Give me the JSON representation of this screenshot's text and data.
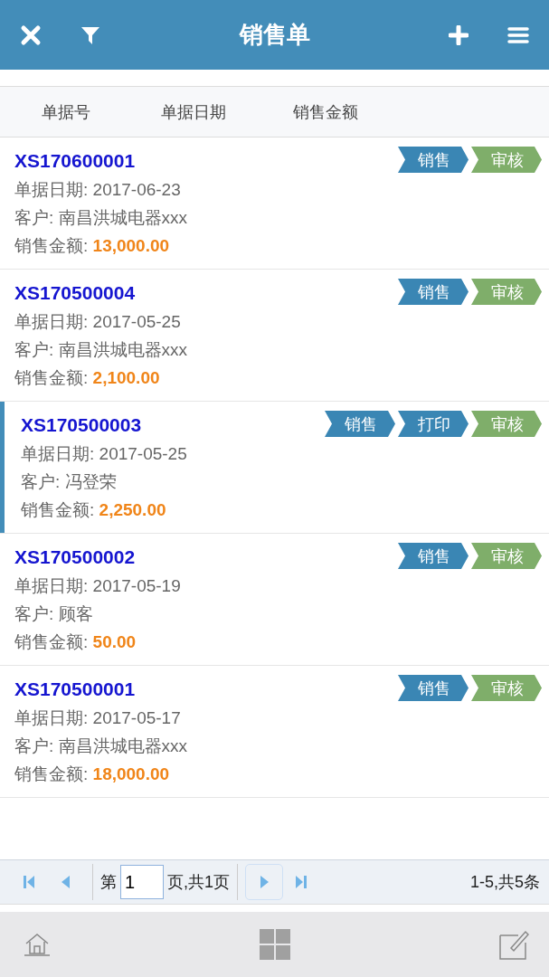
{
  "header": {
    "title": "销售单"
  },
  "columns": [
    "单据号",
    "单据日期",
    "销售金额"
  ],
  "orders": [
    {
      "number": "XS170600001",
      "selected": false,
      "tags": [
        {
          "label": "销售",
          "color": "#3a86b4"
        },
        {
          "label": "审核",
          "color": "#7fae6a"
        }
      ],
      "lines": [
        {
          "label": "单据日期:",
          "value": "2017-06-23",
          "kind": "plain"
        },
        {
          "label": "客户:",
          "value": "南昌洪城电器xxx",
          "kind": "plain"
        },
        {
          "label": "销售金额:",
          "value": "13,000.00",
          "kind": "amount"
        }
      ]
    },
    {
      "number": "XS170500004",
      "selected": false,
      "tags": [
        {
          "label": "销售",
          "color": "#3a86b4"
        },
        {
          "label": "审核",
          "color": "#7fae6a"
        }
      ],
      "lines": [
        {
          "label": "单据日期:",
          "value": "2017-05-25",
          "kind": "plain"
        },
        {
          "label": "客户:",
          "value": "南昌洪城电器xxx",
          "kind": "plain"
        },
        {
          "label": "销售金额:",
          "value": "2,100.00",
          "kind": "amount"
        }
      ]
    },
    {
      "number": "XS170500003",
      "selected": true,
      "tags": [
        {
          "label": "销售",
          "color": "#3a86b4"
        },
        {
          "label": "打印",
          "color": "#3a86b4"
        },
        {
          "label": "审核",
          "color": "#7fae6a"
        }
      ],
      "lines": [
        {
          "label": "单据日期:",
          "value": "2017-05-25",
          "kind": "plain"
        },
        {
          "label": "客户:",
          "value": "冯登荣",
          "kind": "plain"
        },
        {
          "label": "销售金额:",
          "value": "2,250.00",
          "kind": "amount"
        }
      ]
    },
    {
      "number": "XS170500002",
      "selected": false,
      "tags": [
        {
          "label": "销售",
          "color": "#3a86b4"
        },
        {
          "label": "审核",
          "color": "#7fae6a"
        }
      ],
      "lines": [
        {
          "label": "单据日期:",
          "value": "2017-05-19",
          "kind": "plain"
        },
        {
          "label": "客户:",
          "value": "顾客",
          "kind": "plain"
        },
        {
          "label": "销售金额:",
          "value": "50.00",
          "kind": "amount"
        }
      ]
    },
    {
      "number": "XS170500001",
      "selected": false,
      "tags": [
        {
          "label": "销售",
          "color": "#3a86b4"
        },
        {
          "label": "审核",
          "color": "#7fae6a"
        }
      ],
      "lines": [
        {
          "label": "单据日期:",
          "value": "2017-05-17",
          "kind": "plain"
        },
        {
          "label": "客户:",
          "value": "南昌洪城电器xxx",
          "kind": "plain"
        },
        {
          "label": "销售金额:",
          "value": "18,000.00",
          "kind": "amount"
        }
      ]
    }
  ],
  "pager": {
    "page_prefix": "第",
    "page_value": "1",
    "page_suffix": "页,共1页",
    "summary": "1-5,共5条"
  }
}
